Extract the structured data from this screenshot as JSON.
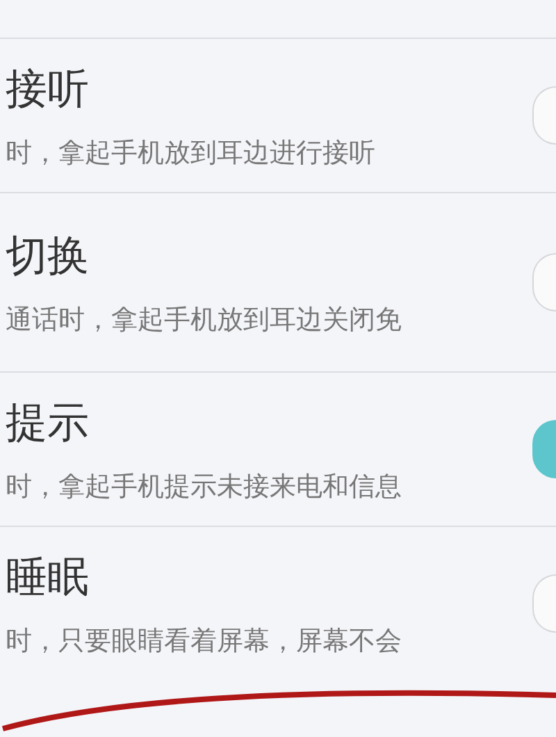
{
  "settings": [
    {
      "title": "接听",
      "description": "时，拿起手机放到耳边进行接听",
      "on": false
    },
    {
      "title": "切换",
      "description": "通话时，拿起手机放到耳边关闭免",
      "on": false
    },
    {
      "title": "提示",
      "description": "时，拿起手机提示未接来电和信息",
      "on": true
    },
    {
      "title": "睡眠",
      "description": "时，只要眼睛看着屏幕，屏幕不会",
      "on": false
    }
  ]
}
